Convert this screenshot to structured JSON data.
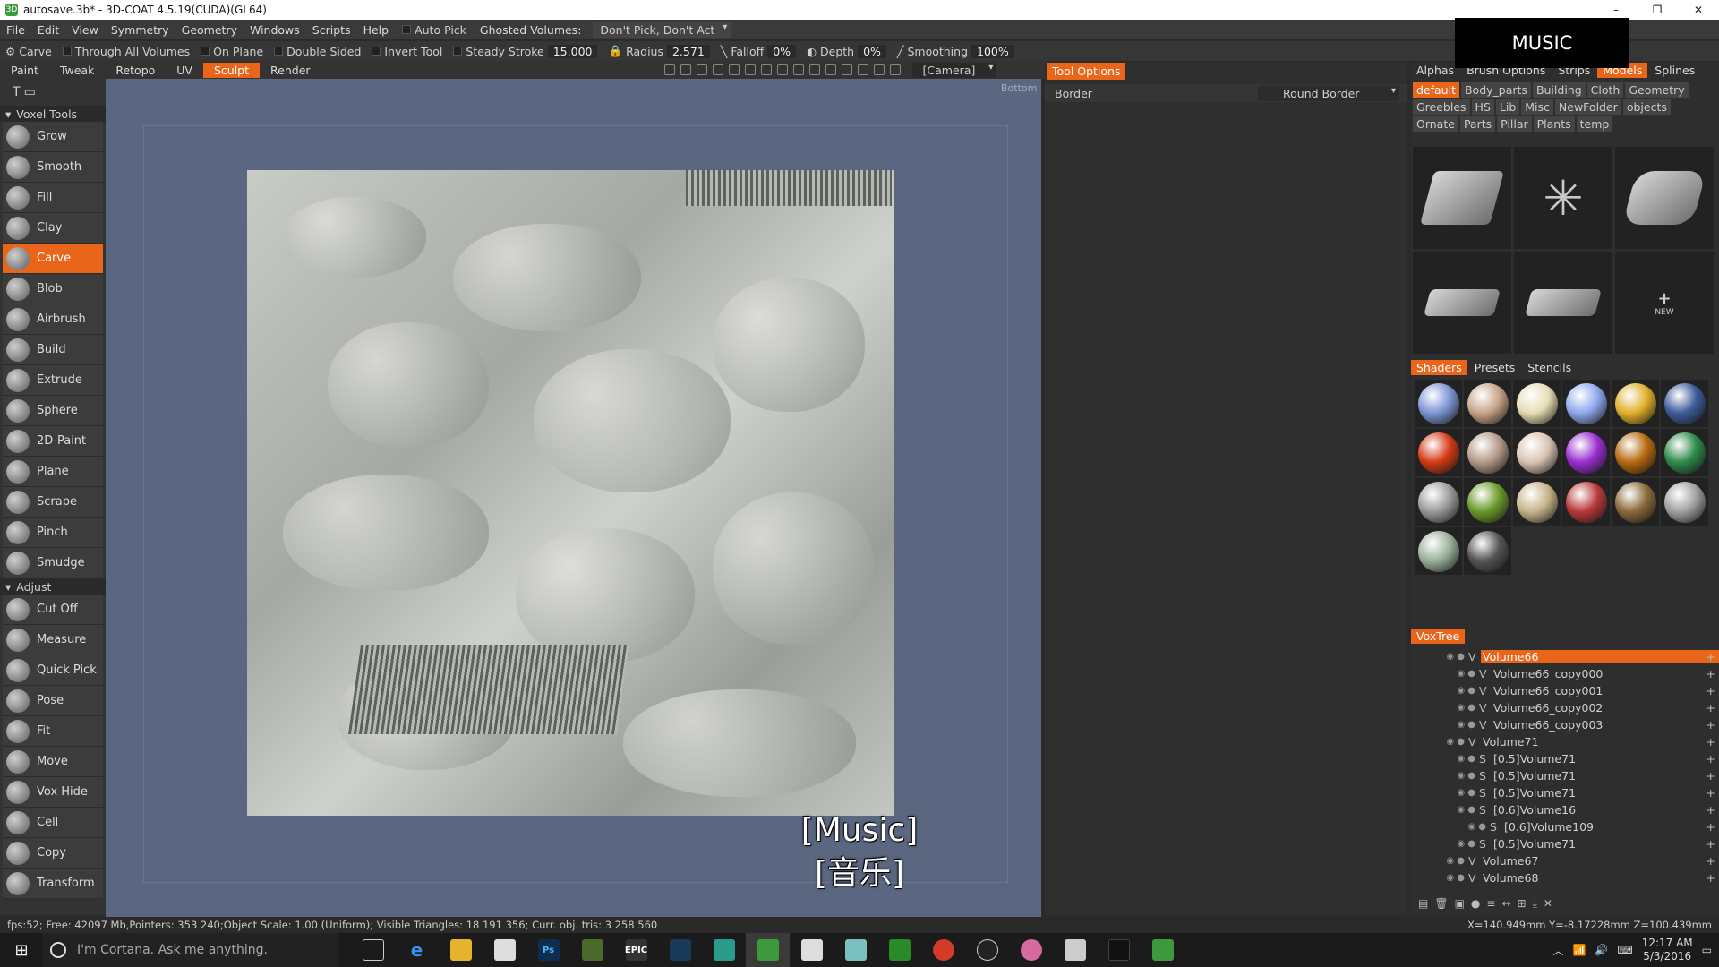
{
  "window": {
    "title": "autosave.3b* - 3D-COAT 4.5.19(CUDA)(GL64)",
    "min": "–",
    "max": "❐",
    "close": "✕"
  },
  "menu": {
    "items": [
      "File",
      "Edit",
      "View",
      "Symmetry",
      "Geometry",
      "Windows",
      "Scripts",
      "Help"
    ],
    "autopick": "Auto Pick",
    "ghosted_label": "Ghosted Volumes:",
    "ghosted_value": "Don't Pick, Don't Act"
  },
  "overlay_title": "MUSIC",
  "toolbar": {
    "tool": "Carve",
    "through": "Through All Volumes",
    "onplane": "On Plane",
    "doublesided": "Double Sided",
    "invert": "Invert Tool",
    "steady": "Steady Stroke",
    "steady_val": "15.000",
    "radius": "Radius",
    "radius_val": "2.571",
    "falloff": "Falloff",
    "falloff_val": "0%",
    "depth": "Depth",
    "depth_val": "0%",
    "smoothing": "Smoothing",
    "smoothing_val": "100%"
  },
  "rooms": {
    "tabs": [
      "Paint",
      "Tweak",
      "Retopo",
      "UV",
      "Sculpt",
      "Render"
    ],
    "active": "Sculpt",
    "camera": "[Camera]"
  },
  "left": {
    "voxel_header": "Voxel Tools",
    "voxel_tools": [
      "Grow",
      "Smooth",
      "Fill",
      "Clay",
      "Carve",
      "Blob",
      "Airbrush",
      "Build",
      "Extrude",
      "Sphere",
      "2D-Paint",
      "Plane",
      "Scrape",
      "Pinch",
      "Smudge"
    ],
    "active_tool": "Carve",
    "adjust_header": "Adjust",
    "adjust_tools": [
      "Cut Off",
      "Measure",
      "Quick Pick",
      "Pose",
      "Fit",
      "Move",
      "Vox Hide",
      "Cell",
      "Copy",
      "Transform"
    ]
  },
  "viewport": {
    "view_label": "Bottom",
    "subtitle_en": "[Music]",
    "subtitle_zh": "[音乐]"
  },
  "tool_options": {
    "tab": "Tool Options",
    "border_label": "Border",
    "border_value": "Round Border"
  },
  "right": {
    "tabs": [
      "Alphas",
      "Brush Options",
      "Strips",
      "Models",
      "Splines"
    ],
    "active_tab": "Models",
    "categories": [
      "default",
      "Body_parts",
      "Building",
      "Cloth",
      "Geometry",
      "Greebles",
      "HS",
      "Lib",
      "Misc",
      "NewFolder",
      "objects",
      "Ornate",
      "Parts",
      "Pillar",
      "Plants",
      "temp"
    ],
    "active_category": "default",
    "new_label": "NEW",
    "shader_tabs": [
      "Shaders",
      "Presets",
      "Stencils"
    ],
    "active_shader_tab": "Shaders",
    "shader_colors": [
      "#7d95d6",
      "#c9a48a",
      "#e6dcb4",
      "#8fa8ee",
      "#e0b02c",
      "#3f5c9a",
      "#d33a14",
      "#b49a88",
      "#d9c4b4",
      "#9a2ed0",
      "#b46a10",
      "#2f8a4a",
      "#9a9a9a",
      "#6a9a2a",
      "#c6b48a",
      "#b83a3a",
      "#8a6a3a",
      "#a0a0a0",
      "#9ab09a",
      "#555555"
    ],
    "voxtree_header": "VoxTree",
    "voxtree": [
      {
        "name": "Volume66",
        "type": "V",
        "level": 0,
        "active": true
      },
      {
        "name": "Volume66_copy000",
        "type": "V",
        "level": 1,
        "active": false
      },
      {
        "name": "Volume66_copy001",
        "type": "V",
        "level": 1,
        "active": false
      },
      {
        "name": "Volume66_copy002",
        "type": "V",
        "level": 1,
        "active": false
      },
      {
        "name": "Volume66_copy003",
        "type": "V",
        "level": 1,
        "active": false
      },
      {
        "name": "Volume71",
        "type": "V",
        "level": 0,
        "active": false
      },
      {
        "name": "[0.5]Volume71",
        "type": "S",
        "level": 1,
        "active": false
      },
      {
        "name": "[0.5]Volume71",
        "type": "S",
        "level": 1,
        "active": false
      },
      {
        "name": "[0.5]Volume71",
        "type": "S",
        "level": 1,
        "active": false
      },
      {
        "name": "[0.6]Volume16",
        "type": "S",
        "level": 1,
        "active": false
      },
      {
        "name": "[0.6]Volume109",
        "type": "S",
        "level": 2,
        "active": false
      },
      {
        "name": "[0.5]Volume71",
        "type": "S",
        "level": 1,
        "active": false
      },
      {
        "name": "Volume67",
        "type": "V",
        "level": 0,
        "active": false
      },
      {
        "name": "Volume68",
        "type": "V",
        "level": 0,
        "active": false
      }
    ]
  },
  "status": {
    "text": "fps:52;    Free: 42097 Mb,Pointers: 353 240;Object Scale: 1.00 (Uniform); Visible Triangles: 18 191 356; Curr. obj. tris: 3 258 560",
    "coords": "X=140.949mm  Y=-8.17228mm  Z=100.439mm"
  },
  "taskbar": {
    "cortana": "I'm Cortana. Ask me anything.",
    "time": "12:17 AM",
    "date": "5/3/2016"
  }
}
